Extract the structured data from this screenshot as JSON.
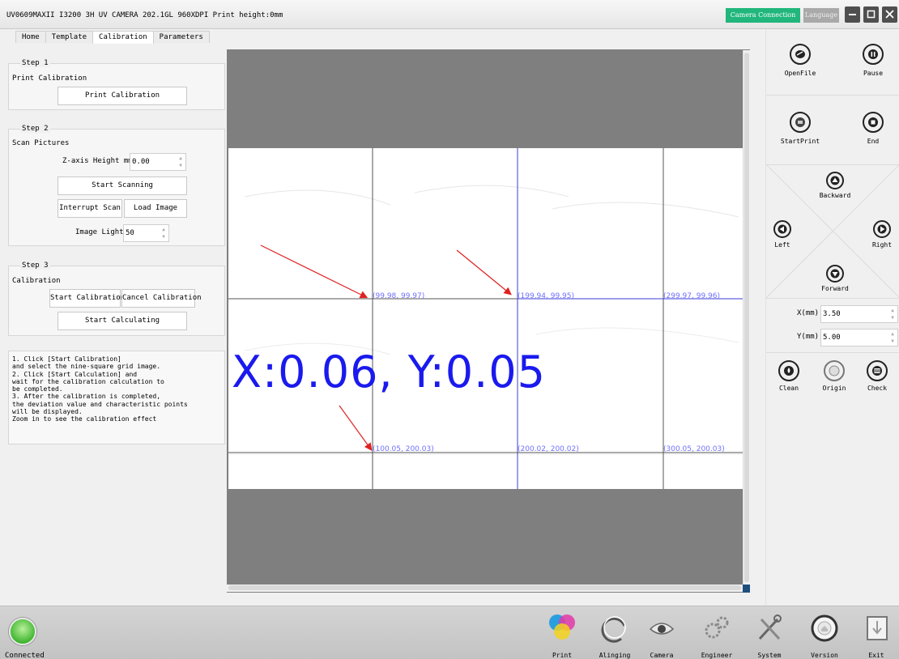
{
  "window": {
    "title": "UV0609MAXII I3200 3H UV CAMERA 202.1GL 960XDPI Print height:0mm",
    "camera_connection": "Camera Connection",
    "language": "Language"
  },
  "tabs": [
    {
      "label": "Home",
      "active": false
    },
    {
      "label": "Template",
      "active": false
    },
    {
      "label": "Calibration",
      "active": true
    },
    {
      "label": "Parameters",
      "active": false
    }
  ],
  "step1": {
    "title": "Step 1",
    "label": "Print Calibration",
    "button": "Print Calibration"
  },
  "step2": {
    "title": "Step 2",
    "label": "Scan Pictures",
    "z_label": "Z-axis Height mm:",
    "z_value": "0.00",
    "start_scanning": "Start Scanning",
    "interrupt_scan": "Interrupt Scan",
    "load_image": "Load Image",
    "light_label": "Image Light:",
    "light_value": "50"
  },
  "step3": {
    "title": "Step 3",
    "label": "Calibration",
    "start_calibration": "Start Calibration",
    "cancel_calibration": "Cancel Calibration",
    "start_calculating": "Start Calculating"
  },
  "help": [
    "1. Click [Start Calibration]",
    "and select the nine-square grid image.",
    "2. Click [Start Calculation] and",
    "wait for the calibration calculation to",
    "be completed.",
    "3. After the calibration is completed,",
    "the deviation value and characteristic points",
    "will be displayed.",
    "Zoom in to see the calibration effect"
  ],
  "viewer": {
    "deviation": "X:0.06, Y:0.05",
    "coords": [
      "(99.98, 99.97)",
      "(199.94, 99.95)",
      "(299.97, 99.96)",
      "(100.05, 200.03)",
      "(200.02, 200.02)",
      "(300.05, 200.03)"
    ]
  },
  "right": {
    "openfile": "OpenFile",
    "pause": "Pause",
    "startprint": "StartPrint",
    "end": "End",
    "backward": "Backward",
    "left": "Left",
    "right": "Right",
    "forward": "Forward",
    "x_label": "X(mm)",
    "x_value": "3.50",
    "y_label": "Y(mm)",
    "y_value": "5.00",
    "clean": "Clean",
    "origin": "Origin",
    "check": "Check"
  },
  "bottom": {
    "status": "Connected",
    "items": [
      "Print",
      "Alinging",
      "Camera",
      "Engineer",
      "System",
      "Version",
      "Exit"
    ]
  },
  "colors": {
    "camera_connection": "#21b67c",
    "status_green": "#41b631",
    "deviation_text": "#1a1aee",
    "coord_text": "#7070ff",
    "arrow": "#e02020"
  }
}
